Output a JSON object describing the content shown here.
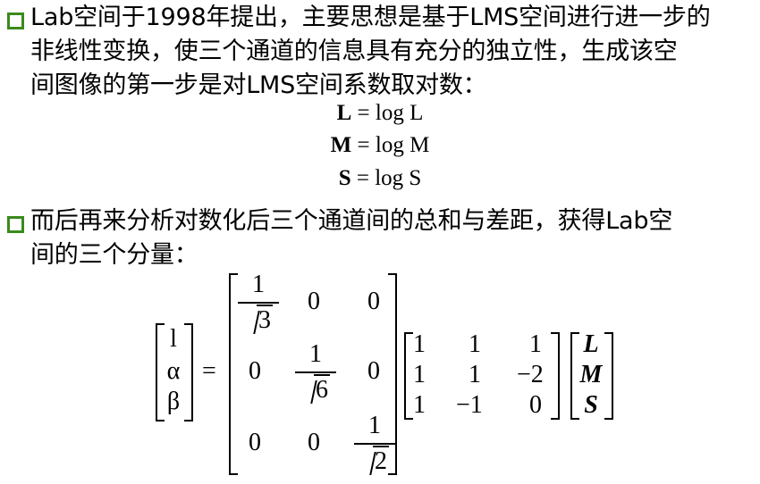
{
  "paragraph1": {
    "line1": "Lab空间于1998年提出，主要思想是基于LMS空间进行进一步的",
    "line2": "非线性变换，使三个通道的信息具有充分的独立性，生成该空",
    "line3": "间图像的第一步是对LMS空间系数取对数："
  },
  "equations": [
    {
      "lhs": "L",
      "rhs": "= log L"
    },
    {
      "lhs": "M",
      "rhs": "= log M"
    },
    {
      "lhs": "S",
      "rhs": "= log S"
    }
  ],
  "paragraph2": {
    "line1": "而后再来分析对数化后三个通道间的总和与差距，获得Lab空",
    "line2": "间的三个分量："
  },
  "matrix": {
    "lhs_vector": [
      "l",
      "α",
      "β"
    ],
    "equals": "=",
    "diag": {
      "r1c1_num": "1",
      "r1c1_den": "3",
      "r2c2_num": "1",
      "r2c2_den": "6",
      "r3c3_num": "1",
      "r3c3_den": "2",
      "zero": "0"
    },
    "transform": [
      [
        "1",
        "1",
        "1"
      ],
      [
        "1",
        "1",
        "−2"
      ],
      [
        "1",
        "−1",
        "0"
      ]
    ],
    "rhs_vector": [
      "L",
      "M",
      "S"
    ]
  },
  "colors": {
    "bullet": "#3a8a1c"
  }
}
